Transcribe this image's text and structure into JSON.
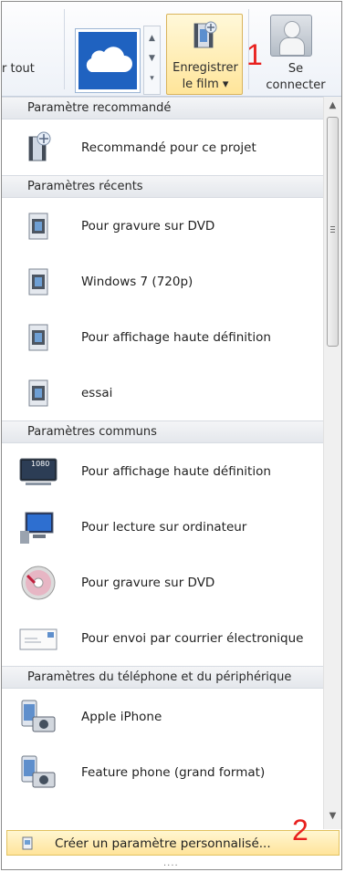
{
  "ribbon": {
    "partial_label": "r tout",
    "save_button": {
      "line1": "Enregistrer",
      "line2": "le film ▾"
    },
    "connect_button": {
      "line1": "Se",
      "line2": "connecter"
    }
  },
  "annotations": {
    "marker_1": "1",
    "marker_2": "2"
  },
  "sections": [
    {
      "title": "Paramètre recommandé",
      "items": [
        {
          "label": "Recommandé pour ce projet",
          "icon": "recommended-settings-icon"
        }
      ]
    },
    {
      "title": "Paramètres récents",
      "items": [
        {
          "label": "Pour gravure sur DVD",
          "icon": "film-strip-icon"
        },
        {
          "label": "Windows 7 (720p)",
          "icon": "film-strip-icon"
        },
        {
          "label": "Pour affichage haute définition",
          "icon": "film-strip-icon"
        },
        {
          "label": "essai",
          "icon": "film-strip-icon"
        }
      ]
    },
    {
      "title": "Paramètres communs",
      "items": [
        {
          "label": "Pour affichage haute définition",
          "icon": "hd-display-icon"
        },
        {
          "label": "Pour lecture sur ordinateur",
          "icon": "computer-icon"
        },
        {
          "label": "Pour gravure sur DVD",
          "icon": "dvd-icon"
        },
        {
          "label": "Pour envoi par courrier électronique",
          "icon": "email-icon"
        }
      ]
    },
    {
      "title": "Paramètres du téléphone et du périphérique",
      "items": [
        {
          "label": "Apple iPhone",
          "icon": "phone-camera-icon"
        },
        {
          "label": "Feature phone (grand format)",
          "icon": "phone-camera-icon"
        }
      ]
    }
  ],
  "hd_badge": "1080",
  "footer": {
    "label": "Créer un paramètre personnalisé..."
  },
  "colors": {
    "accent_highlight": "#ffe59a",
    "section_bg": "#e9ecf0",
    "marker_red": "#e8201e"
  }
}
